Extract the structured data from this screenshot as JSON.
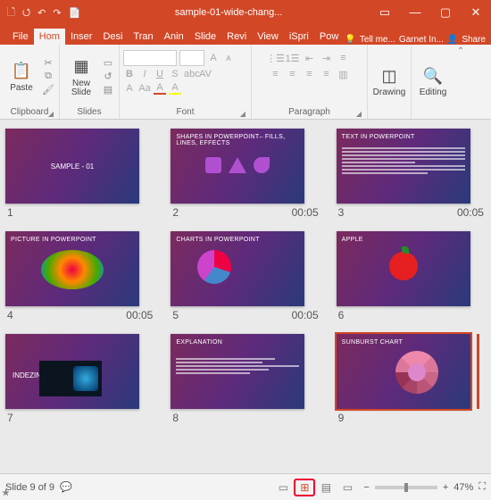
{
  "titlebar": {
    "title": "sample-01-wide-chang...",
    "qat": [
      "🗋",
      "⭯",
      "↶",
      "↷",
      "📄"
    ],
    "win": [
      "▭",
      "—",
      "▢",
      "✕"
    ]
  },
  "tabs": {
    "file_label": "File",
    "items": [
      "Home",
      "Insert",
      "Design",
      "Transitions",
      "Animations",
      "Slide Show",
      "Review",
      "View",
      "iSpring",
      "PowerPoint"
    ],
    "items_short": [
      "Hom",
      "Inser",
      "Desi",
      "Tran",
      "Anin",
      "Slide",
      "Revi",
      "View",
      "iSpri",
      "Pow"
    ],
    "active_index": 0,
    "tellme": "Tell me...",
    "user": "Garnet In...",
    "share": "Share"
  },
  "ribbon": {
    "clipboard": {
      "label": "Clipboard",
      "paste": "Paste"
    },
    "slides": {
      "label": "Slides",
      "new": "New Slide"
    },
    "font": {
      "label": "Font"
    },
    "paragraph": {
      "label": "Paragraph"
    },
    "drawing": {
      "label": "Drawing"
    },
    "editing": {
      "label": "Editing"
    }
  },
  "slides": [
    {
      "n": "1",
      "title": "SAMPLE - 01",
      "kind": "title",
      "time": ""
    },
    {
      "n": "2",
      "title": "SHAPES IN POWERPOINT– FILLS, LINES, EFFECTS",
      "kind": "shapes",
      "time": "00:05"
    },
    {
      "n": "3",
      "title": "TEXT IN POWERPOINT",
      "kind": "text",
      "time": "00:05"
    },
    {
      "n": "4",
      "title": "PICTURE IN POWERPOINT",
      "kind": "picture",
      "time": "00:05"
    },
    {
      "n": "5",
      "title": "CHARTS IN POWERPOINT",
      "kind": "chart",
      "time": "00:05"
    },
    {
      "n": "6",
      "title": "APPLE",
      "kind": "apple",
      "time": ""
    },
    {
      "n": "7",
      "title": "INDEZINE",
      "kind": "indezine",
      "time": ""
    },
    {
      "n": "8",
      "title": "EXPLANATION",
      "kind": "explain",
      "time": ""
    },
    {
      "n": "9",
      "title": "SUNBURST CHART",
      "kind": "sunburst",
      "time": "",
      "selected": true
    }
  ],
  "status": {
    "pos": "Slide 9 of 9",
    "zoom": "47%"
  }
}
